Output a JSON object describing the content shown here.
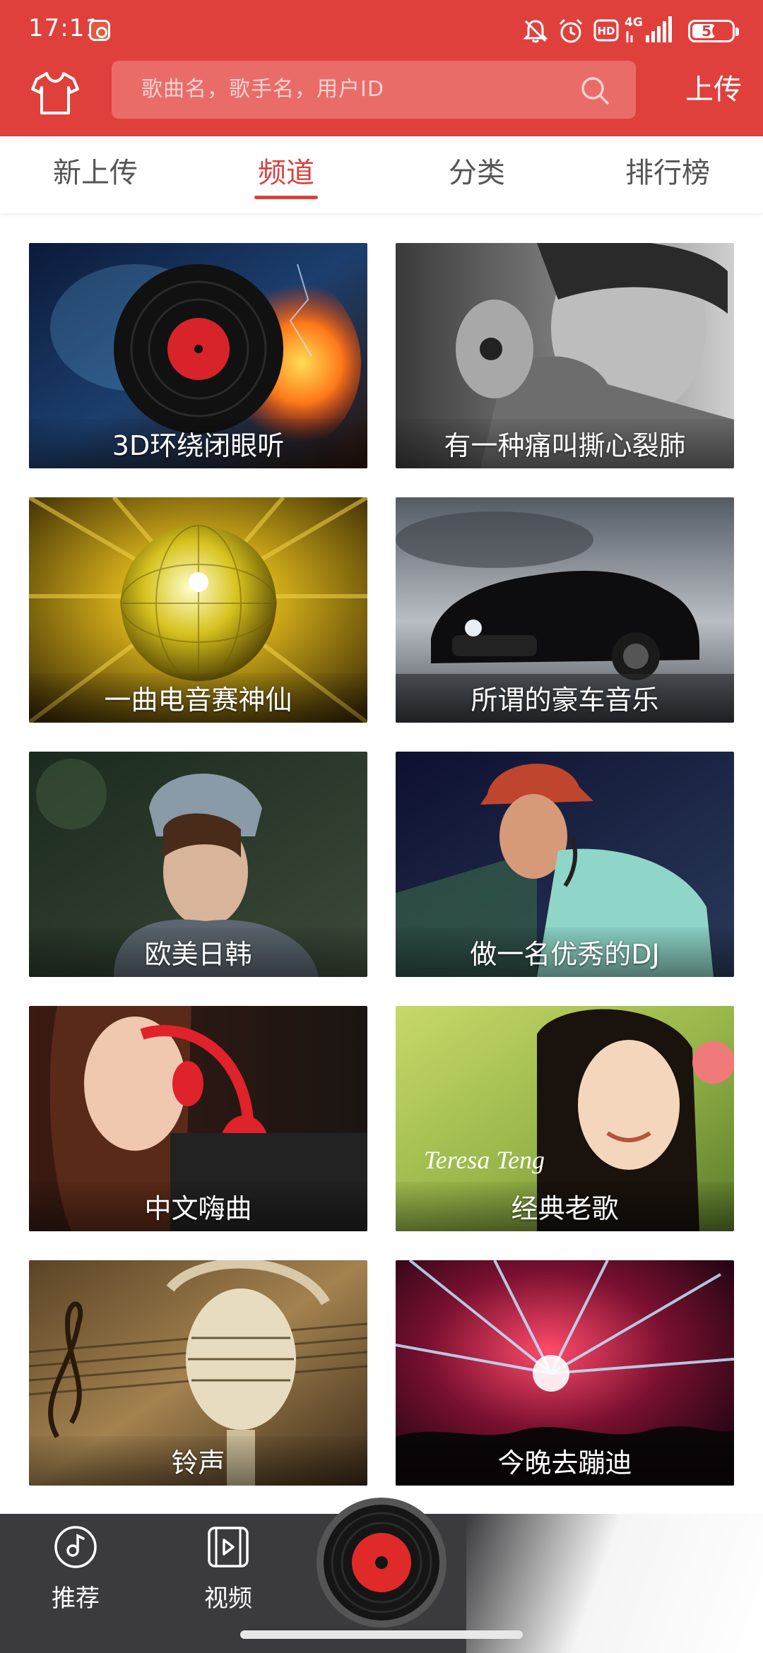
{
  "status_bar": {
    "time": "17:11",
    "network": "4G",
    "hd": "HD",
    "battery": "56"
  },
  "header": {
    "search_placeholder": "歌曲名，歌手名，用户ID",
    "upload_label": "上传",
    "accent_color": "#e0403c"
  },
  "tabs": [
    {
      "label": "新上传",
      "active": false
    },
    {
      "label": "频道",
      "active": true
    },
    {
      "label": "分类",
      "active": false
    },
    {
      "label": "排行榜",
      "active": false
    }
  ],
  "channels": [
    {
      "title": "3D环绕闭眼听"
    },
    {
      "title": "有一种痛叫撕心裂肺"
    },
    {
      "title": "一曲电音赛神仙"
    },
    {
      "title": "所谓的豪车音乐"
    },
    {
      "title": "欧美日韩"
    },
    {
      "title": "做一名优秀的DJ"
    },
    {
      "title": "中文嗨曲"
    },
    {
      "title": "经典老歌"
    },
    {
      "title": "铃声"
    },
    {
      "title": "今晚去蹦迪"
    }
  ],
  "card_text": {
    "teresa_teng": "Teresa Teng"
  },
  "bottom_nav": [
    {
      "label": "推荐",
      "icon": "music-note-icon"
    },
    {
      "label": "视频",
      "icon": "video-icon"
    }
  ]
}
